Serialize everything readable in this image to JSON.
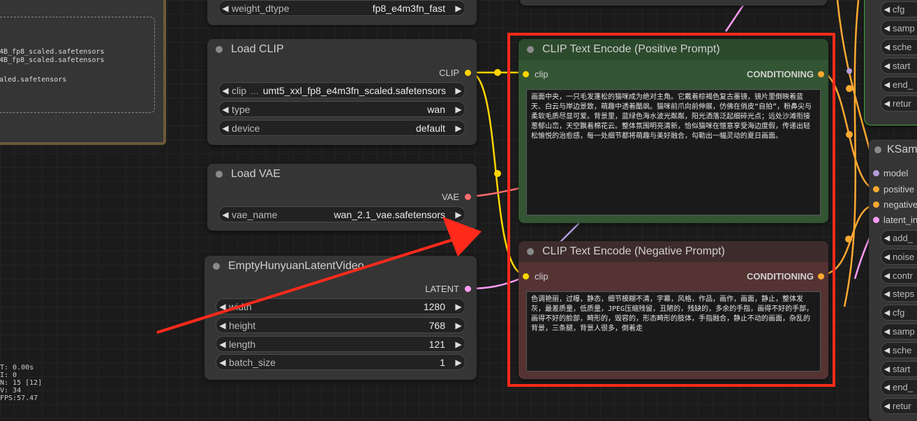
{
  "top_node": {
    "label": "weight_dtype",
    "value": "fp8_e4m3fn_fast"
  },
  "left_panel": {
    "lines": [
      "4B_fp8_scaled.safetensors",
      "4B_fp8_scaled.safetensors",
      "aled.safetensors"
    ]
  },
  "stats": {
    "lines": [
      "T: 0.00s",
      "I: 0",
      "N: 15 [12]",
      "V: 34",
      "FPS:57.47"
    ]
  },
  "load_clip": {
    "title": "Load CLIP",
    "output": "CLIP",
    "widgets": [
      {
        "label": "clip",
        "value": "umt5_xxl_fp8_e4m3fn_scaled.safetensors"
      },
      {
        "label": "type",
        "value": "wan"
      },
      {
        "label": "device",
        "value": "default"
      }
    ]
  },
  "load_vae": {
    "title": "Load VAE",
    "output": "VAE",
    "widget": {
      "label": "vae_name",
      "value": "wan_2.1_vae.safetensors"
    }
  },
  "latent_video": {
    "title": "EmptyHunyuanLatentVideo",
    "output": "LATENT",
    "widgets": [
      {
        "label": "width",
        "value": "1280"
      },
      {
        "label": "height",
        "value": "768"
      },
      {
        "label": "length",
        "value": "121"
      },
      {
        "label": "batch_size",
        "value": "1"
      }
    ]
  },
  "positive": {
    "title": "CLIP Text Encode (Positive Prompt)",
    "input": "clip",
    "output": "CONDITIONING",
    "text": "画面中央，一只毛发蓬松的猫咪成为绝对主角。它戴着棕褐色复古墨镜，镜片里倒映着蓝天、白云与岸边景致，萌趣中透着酷飒。猫咪前爪向前伸展，仿佛在俏皮“自拍”，粉鼻尖与柔软毛质尽显可爱。背景里，蓝绿色海水波光粼粼，阳光洒落泛起细碎光点；远处沙滩衔接葱郁山峦，天空飘着棉花云。整体氛围明亮清新，恰似猫咪在惬意享受海边度假，传递出轻松愉悦的治愈感，每一处细节都将萌趣与美好融合，勾勒出一幅灵动的夏日画面。"
  },
  "negative": {
    "title": "CLIP Text Encode (Negative Prompt)",
    "input": "clip",
    "output": "CONDITIONING",
    "text": "色调艳丽，过曝，静态，细节模糊不清，字幕，风格，作品，画作，画面，静止，整体发灰，最差质量，低质量，JPEG压缩残留，丑陋的，残缺的，多余的手指，画得不好的手部，画得不好的脸部，畸形的，毁容的，形态畸形的肢体，手指融合，静止不动的画面，杂乱的背景，三条腿，背景人很多，倒着走"
  },
  "right_top_rows": [
    "cfg",
    "samp",
    "sche",
    "start",
    "end_",
    "retur"
  ],
  "ksampler": {
    "title": "KSam",
    "inputs": [
      {
        "label": "model",
        "color": "#b39ddb"
      },
      {
        "label": "positive",
        "color": "#ffa931"
      },
      {
        "label": "negative",
        "color": "#ffa931"
      },
      {
        "label": "latent_in",
        "color": "#ff9cf9"
      }
    ],
    "rows": [
      "add_",
      "noise",
      "contr",
      "steps",
      "cfg",
      "samp",
      "sche",
      "start",
      "end_",
      "retur"
    ]
  },
  "colors": {
    "highlight": "#ff2a1a",
    "clip_wire": "#ffd500",
    "vae_wire": "#ff6e6e",
    "latent_wire": "#ff9cf9",
    "cond_wire": "#ffa931"
  }
}
